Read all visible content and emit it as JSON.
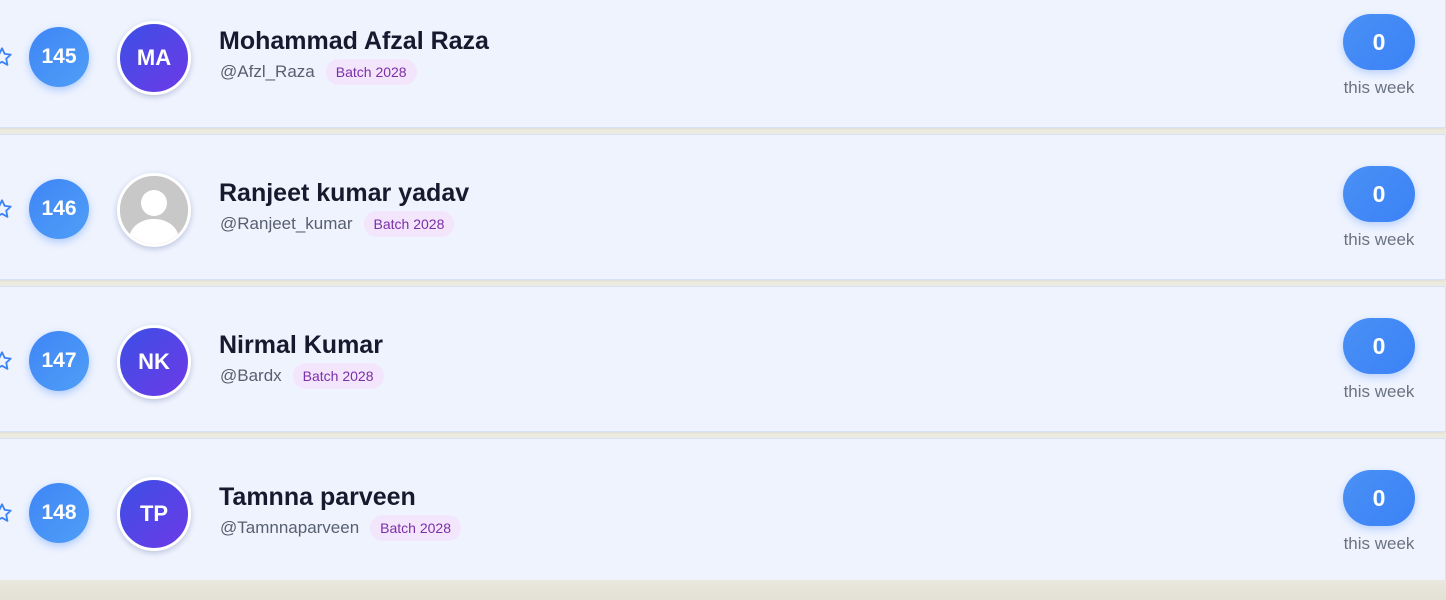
{
  "leaderboard": {
    "rows": [
      {
        "rank": "145",
        "initials": "MA",
        "avatar_type": "initials",
        "name": "Mohammad Afzal Raza",
        "handle": "@Afzl_Raza",
        "batch": "Batch 2028",
        "count": "0",
        "period": "this week"
      },
      {
        "rank": "146",
        "initials": "",
        "avatar_type": "placeholder-user-icon",
        "name": "Ranjeet kumar yadav",
        "handle": "@Ranjeet_kumar",
        "batch": "Batch 2028",
        "count": "0",
        "period": "this week"
      },
      {
        "rank": "147",
        "initials": "NK",
        "avatar_type": "initials",
        "name": "Nirmal Kumar",
        "handle": "@Bardx",
        "batch": "Batch 2028",
        "count": "0",
        "period": "this week"
      },
      {
        "rank": "148",
        "initials": "TP",
        "avatar_type": "initials",
        "name": "Tamnna parveen",
        "handle": "@Tamnnaparveen",
        "batch": "Batch 2028",
        "count": "0",
        "period": "this week"
      }
    ]
  },
  "colors": {
    "row_background": "#eef3fe",
    "rank_circle": "#3f86f5",
    "avatar_gradient_start": "#3c4fe6",
    "avatar_gradient_end": "#6d3ae6",
    "badge_background": "#f3e5fb",
    "badge_text": "#7b2fa8",
    "count_pill": "#3b82f6",
    "star_outline": "#3b82f6"
  }
}
